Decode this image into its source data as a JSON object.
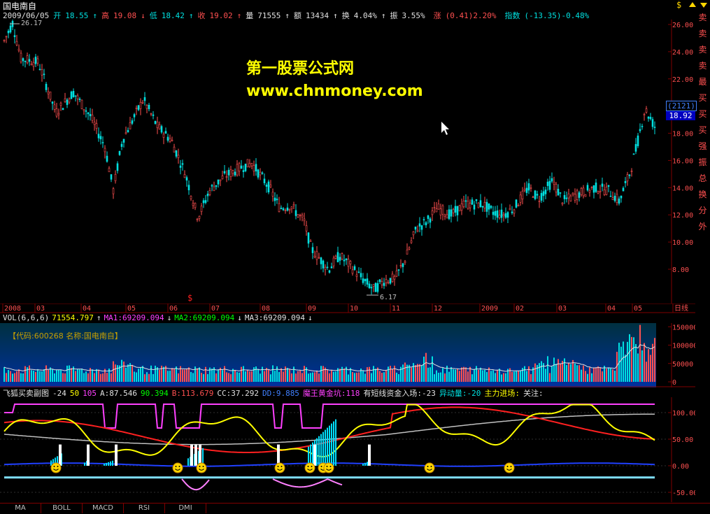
{
  "stock": {
    "name": "国电南自",
    "code_label": "【代码:600268 名称:国电南自】"
  },
  "quote": {
    "date": "2009/06/05",
    "open_label": "开",
    "open": "18.55",
    "high_label": "高",
    "high": "19.08",
    "low_label": "低",
    "low": "18.42",
    "close_label": "收",
    "close": "19.02",
    "vol_label": "量",
    "vol": "71555",
    "amt_label": "额",
    "amt": "13434",
    "turn_label": "换",
    "turn": "4.04%",
    "amp_label": "振",
    "amp": "3.55%",
    "chg_label": "涨",
    "chg": "(0.41)2.20%",
    "idx_label": "指数",
    "idx": "(-13.35)-0.48%"
  },
  "watermark": {
    "line1": "第一股票公式网",
    "line2": "www.chnmoney.com"
  },
  "price_axis": [
    "26.00",
    "24.00",
    "22.00",
    "20.00",
    "18.00",
    "16.00",
    "14.00",
    "12.00",
    "10.00",
    "8.00"
  ],
  "price_labels": {
    "max": "26.17",
    "min": "6.17",
    "box1": "(2121)",
    "box2": "18.92"
  },
  "right_sidebar": [
    "卖",
    "卖",
    "卖",
    "卖",
    "最",
    "买",
    "买",
    "买",
    "强",
    "振",
    "总",
    "换",
    "分",
    "外"
  ],
  "date_axis": [
    "2008",
    "03",
    "04",
    "05",
    "06",
    "07",
    "08",
    "09",
    "10",
    "11",
    "12",
    "2009",
    "02",
    "03",
    "04",
    "05",
    "日线"
  ],
  "vol_header": {
    "name": "VOL(6,6,6)",
    "v": "71554.797",
    "ma1": "MA1:69209.094",
    "ma2": "MA2:69209.094",
    "ma3": "MA3:69209.094"
  },
  "vol_axis": [
    "150000",
    "100000",
    "50000",
    "0"
  ],
  "ind_header": {
    "name": "飞狐买卖副图",
    "p1": "-24",
    "p2": "50",
    "p3": "105",
    "a": "A:87.546",
    "b1": "90.394",
    "b": "B:113.679",
    "cc": "CC:37.292",
    "dd": "DD:9.885",
    "mw": "魔王黄金坑:118",
    "dx": "有短线资金入场:-23",
    "yd": "异动量:-20",
    "zl": "主力进场:",
    "gz": "关注:"
  },
  "ind_axis": [
    "100.00",
    "50.00",
    "0.00",
    "-50.00"
  ],
  "tabs": [
    "MA",
    "BOLL",
    "MACD",
    "RSI",
    "DMI"
  ],
  "colors": {
    "up": "#ff5050",
    "down": "#00e0e0",
    "ma": "#ffffff",
    "accent": "#ffff00",
    "magenta": "#ff40ff"
  },
  "icons": [
    "dollar-icon",
    "up-arrow-icon",
    "down-arrow-icon"
  ]
}
